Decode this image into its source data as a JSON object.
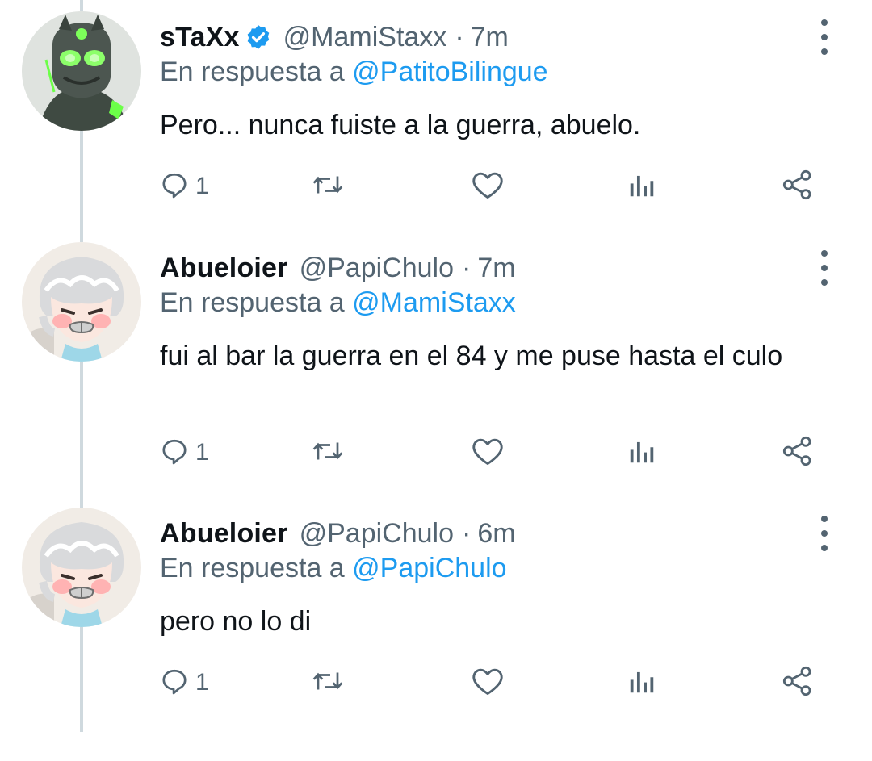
{
  "tweets": [
    {
      "name": "sTaXx",
      "verified": true,
      "handle": "@MamiStaxx",
      "separator": "·",
      "time": "7m",
      "reply_prefix": "En respuesta a",
      "reply_mention": "@PatitoBilingue",
      "text": "Pero... nunca fuiste a la guerra, abuelo.",
      "reply_count": "1",
      "avatar": "green-robot-avatar"
    },
    {
      "name": "Abueloier",
      "verified": false,
      "handle": "@PapiChulo",
      "separator": "·",
      "time": "7m",
      "reply_prefix": "En respuesta a",
      "reply_mention": "@MamiStaxx",
      "text": "fui al bar la guerra en el 84 y me puse hasta el culo",
      "reply_count": "1",
      "avatar": "grandpa-avatar"
    },
    {
      "name": "Abueloier",
      "verified": false,
      "handle": "@PapiChulo",
      "separator": "·",
      "time": "6m",
      "reply_prefix": "En respuesta a",
      "reply_mention": "@PapiChulo",
      "text": "pero no lo di",
      "reply_count": "1",
      "avatar": "grandpa-avatar"
    }
  ],
  "icons": {
    "reply": "reply-icon",
    "retweet": "retweet-icon",
    "like": "heart-icon",
    "views": "analytics-icon",
    "share": "share-icon",
    "more": "more-icon",
    "verified": "verified-badge-icon"
  },
  "colors": {
    "name": "#0f1419",
    "secondary": "#536471",
    "mention": "#1d9bf0",
    "verified": "#1d9bf0",
    "thread_line": "#cfd9de"
  }
}
